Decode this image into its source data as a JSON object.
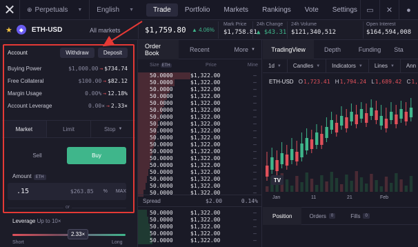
{
  "nav": {
    "logo": "✕",
    "network": "Perpetuals",
    "language": "English",
    "items": [
      "Trade",
      "Portfolio",
      "Markets",
      "Rankings",
      "Vote",
      "Settings"
    ]
  },
  "market": {
    "pair": "ETH-USD",
    "all_markets": "All markets",
    "price": "$1,759.80",
    "change_pct": "4.06%",
    "stats": [
      {
        "label": "Mark Price",
        "value": "$1,758.81"
      },
      {
        "label": "24h Change",
        "value": "$43.31"
      },
      {
        "label": "24h Volume",
        "value": "$121,340,512"
      },
      {
        "label": "Open Interest",
        "value": "$164,594,008"
      }
    ]
  },
  "account": {
    "title": "Account",
    "withdraw": "Withdraw",
    "deposit": "Deposit",
    "rows": [
      {
        "label": "Buying Power",
        "from": "$1,000.00",
        "to": "$734.74"
      },
      {
        "label": "Free Collateral",
        "from": "$100.00",
        "to": "$82.12"
      },
      {
        "label": "Margin Usage",
        "from": "0.00%",
        "to": "12.18%"
      },
      {
        "label": "Account Leverage",
        "from": "0.00×",
        "to": "2.33×"
      }
    ]
  },
  "order": {
    "tabs": [
      "Market",
      "Limit",
      "Stop"
    ],
    "sell": "Sell",
    "buy": "Buy",
    "amount_label": "Amount",
    "amount_unit": "ETH",
    "amount_value": ".15",
    "amount_usd": "$263.85",
    "pct": "%",
    "max": "MAX",
    "or": "or",
    "leverage_label": "Leverage",
    "leverage_hint": "Up to 10×",
    "leverage_value": "2.33×",
    "leverage_level": 0.58,
    "short": "Short",
    "long": "Long"
  },
  "orderbook": {
    "tabs": [
      "Order Book",
      "Recent",
      "More"
    ],
    "headers": {
      "size": "Size",
      "unit": "ETH",
      "price": "Price",
      "mine": "Mine"
    },
    "ask_rows": [
      {
        "size": "50.0000",
        "price": "$1,322.00",
        "mine": "–",
        "depth": 0.72
      },
      {
        "size": "50.0000",
        "price": "$1,322.00",
        "mine": "–",
        "depth": 0.5
      },
      {
        "size": "50.0000",
        "price": "$1,322.00",
        "mine": "–",
        "depth": 0.44
      },
      {
        "size": "50.0000",
        "price": "$1,322.00",
        "mine": "–",
        "depth": 0.4
      },
      {
        "size": "50.0000",
        "price": "$1,322.00",
        "mine": "–",
        "depth": 0.36
      },
      {
        "size": "50.0000",
        "price": "$1,322.00",
        "mine": "–",
        "depth": 0.33
      },
      {
        "size": "50.0000",
        "price": "$1,322.00",
        "mine": "–",
        "depth": 0.3
      },
      {
        "size": "50.0000",
        "price": "$1,322.00",
        "mine": "–",
        "depth": 0.28
      },
      {
        "size": "50.0000",
        "price": "$1,322.00",
        "mine": "–",
        "depth": 0.26
      },
      {
        "size": "50.0000",
        "price": "$1,322.00",
        "mine": "–",
        "depth": 0.24
      },
      {
        "size": "50.0000",
        "price": "$1,322.00",
        "mine": "–",
        "depth": 0.22
      },
      {
        "size": "50.0000",
        "price": "$1,322.00",
        "mine": "–",
        "depth": 0.2
      },
      {
        "size": "50.0000",
        "price": "$1,322.00",
        "mine": "–",
        "depth": 0.18
      },
      {
        "size": "50.0000",
        "price": "$1,322.00",
        "mine": "–",
        "depth": 0.16
      },
      {
        "size": "50.0000",
        "price": "$1,322.00",
        "mine": "–",
        "depth": 0.14
      },
      {
        "size": "50.0000",
        "price": "$1,322.00",
        "mine": "–",
        "depth": 0.12
      },
      {
        "size": "50.0000",
        "price": "$1,322.00",
        "mine": "–",
        "depth": 0.1
      },
      {
        "size": "50.0000",
        "price": "$1,322.00",
        "mine": "–",
        "depth": 0.08
      }
    ],
    "spread": {
      "label": "Spread",
      "value": "$2.00",
      "pct": "0.14%"
    },
    "bid_rows": [
      {
        "size": "50.0000",
        "price": "$1,322.00",
        "mine": "–",
        "depth": 0.12
      },
      {
        "size": "50.0000",
        "price": "$1,322.00",
        "mine": "–",
        "depth": 0.14
      },
      {
        "size": "50.0000",
        "price": "$1,322.00",
        "mine": "–",
        "depth": 0.16
      },
      {
        "size": "50.0000",
        "price": "$1,322.00",
        "mine": "–",
        "depth": 0.18
      },
      {
        "size": "50.0000",
        "price": "$1,322.00",
        "mine": "–",
        "depth": 0.2
      }
    ]
  },
  "chart": {
    "tabs": [
      "TradingView",
      "Depth",
      "Funding",
      "Sta"
    ],
    "tools": [
      "1d",
      "Candles",
      "Indicators",
      "Lines",
      "Ann"
    ],
    "symbol": "ETH-USD",
    "ohlc": [
      {
        "k": "O",
        "v": "1,723.41"
      },
      {
        "k": "H",
        "v": "1,794.24"
      },
      {
        "k": "L",
        "v": "1,689.42"
      },
      {
        "k": "C",
        "v": "1,7"
      }
    ],
    "xlabels": [
      "Jan",
      "11",
      "21",
      "Feb"
    ],
    "colors": {
      "up": "#3fb68b",
      "down": "#e0505a"
    },
    "tv_logo": "TV"
  },
  "positions": {
    "tabs": [
      {
        "label": "Position",
        "count": ""
      },
      {
        "label": "Orders",
        "count": "0"
      },
      {
        "label": "Fills",
        "count": "0"
      }
    ]
  },
  "colors": {
    "accent": "#3fb68b",
    "negative": "#e0505a",
    "highlight": "#e53935"
  }
}
